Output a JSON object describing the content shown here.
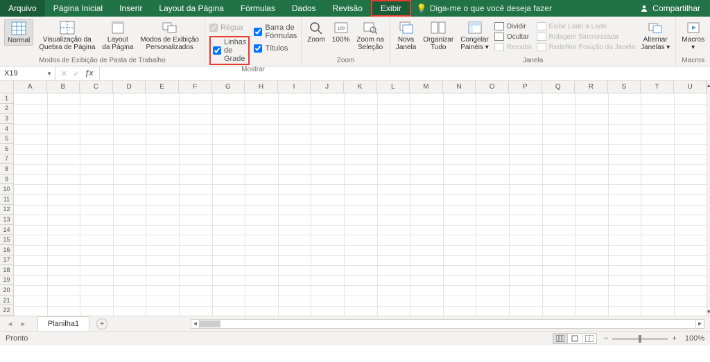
{
  "tabs": [
    "Arquivo",
    "Página Inicial",
    "Inserir",
    "Layout da Página",
    "Fórmulas",
    "Dados",
    "Revisão",
    "Exibir"
  ],
  "active_tab_index": 7,
  "tell_me": "Diga-me o que você deseja fazer",
  "share": "Compartilhar",
  "groups": {
    "views": {
      "label": "Modos de Exibição de Pasta de Trabalho",
      "normal": "Normal",
      "page_break": "Visualização da\nQuebra de Página",
      "page_layout": "Layout\nda Página",
      "custom_views": "Modos de Exibição\nPersonalizados"
    },
    "show": {
      "label": "Mostrar",
      "ruler": "Régua",
      "formula_bar": "Barra de Fórmulas",
      "gridlines": "Linhas de Grade",
      "headings": "Títulos"
    },
    "zoom": {
      "label": "Zoom",
      "zoom": "Zoom",
      "p100": "100%",
      "to_sel": "Zoom na\nSeleção"
    },
    "window": {
      "label": "Janela",
      "new_window": "Nova\nJanela",
      "arrange": "Organizar\nTudo",
      "freeze": "Congelar\nPainéis ▾",
      "split": "Dividir",
      "hide": "Ocultar",
      "unhide": "Reexibir",
      "side_by_side": "Exibir Lado a Lado",
      "sync_scroll": "Rolagem Sincronizada",
      "reset_pos": "Redefinir Posição da Janela",
      "switch": "Alternar\nJanelas ▾"
    },
    "macros": {
      "label": "Macros",
      "macros": "Macros\n▾"
    }
  },
  "namebox": "X19",
  "columns": [
    "A",
    "B",
    "C",
    "D",
    "E",
    "F",
    "G",
    "H",
    "I",
    "J",
    "K",
    "L",
    "M",
    "N",
    "O",
    "P",
    "Q",
    "R",
    "S",
    "T",
    "U"
  ],
  "rows": [
    "1",
    "2",
    "3",
    "4",
    "5",
    "6",
    "7",
    "8",
    "9",
    "10",
    "11",
    "12",
    "13",
    "14",
    "15",
    "16",
    "17",
    "18",
    "19",
    "20",
    "21",
    "22"
  ],
  "sheet": "Planilha1",
  "status": "Pronto",
  "zoom_pct": "100%"
}
